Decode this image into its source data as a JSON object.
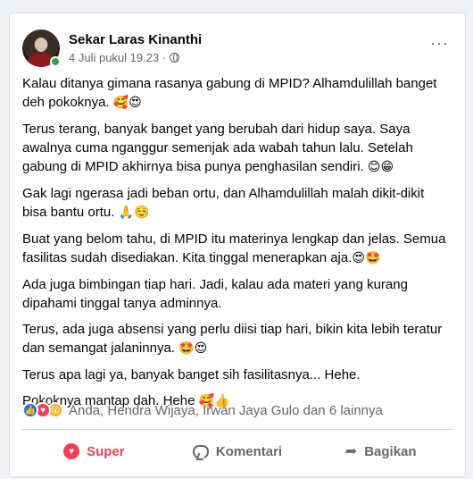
{
  "post": {
    "author": "Sekar Laras Kinanthi",
    "timestamp": "4 Juli pukul 19.23 ·",
    "paragraphs": [
      {
        "text": "Kalau ditanya gimana rasanya gabung di MPID? Alhamdulillah banget deh pokoknya.",
        "emoji": "🥰😍"
      },
      {
        "text": "Terus terang, banyak banget yang berubah dari hidup saya. Saya awalnya cuma nganggur semenjak ada wabah tahun lalu. Setelah gabung di MPID akhirnya bisa punya penghasilan sendiri.",
        "emoji": "😊😁"
      },
      {
        "text": "Gak lagi ngerasa jadi beban ortu, dan Alhamdulillah malah dikit-dikit bisa bantu ortu.",
        "emoji": "🙏☺️"
      },
      {
        "text": "Buat yang belom tahu, di MPID itu materinya lengkap dan jelas. Semua fasilitas sudah disediakan. Kita tinggal menerapkan aja.",
        "emoji": "😍🤩"
      },
      {
        "text": "Ada juga bimbingan tiap hari. Jadi, kalau ada materi yang kurang dipahami tinggal tanya adminnya.",
        "emoji": ""
      },
      {
        "text": "Terus, ada juga absensi yang perlu diisi tiap hari, bikin kita lebih teratur dan semangat jalaninnya.",
        "emoji": "🤩😍"
      },
      {
        "text": "Terus apa lagi ya, banyak banget sih fasilitasnya... Hehe.",
        "emoji": ""
      },
      {
        "text": "Pokoknya mantap dah. Hehe",
        "emoji": "🥰👍"
      }
    ]
  },
  "reactions": {
    "summary": "Anda, Hendra Wijaya, Irwan Jaya Gulo dan 6 lainnya",
    "icons": [
      "like-icon",
      "love-icon",
      "wow-icon"
    ]
  },
  "actions": {
    "super_label": "Super",
    "comment_label": "Komentari",
    "share_label": "Bagikan"
  },
  "colors": {
    "super": "#f33e58",
    "like": "#1877f2",
    "secondary_text": "#65676b",
    "online": "#31a24c"
  }
}
